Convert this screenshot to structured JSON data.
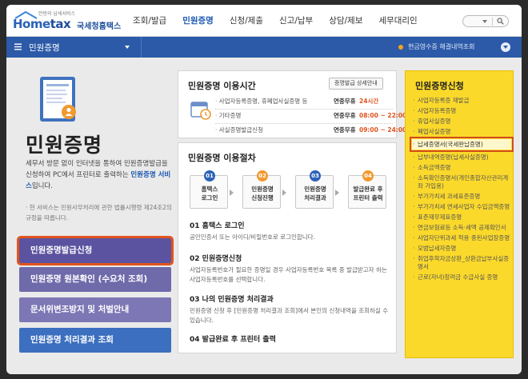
{
  "header": {
    "logo_tagline": "안방의 납세서비스",
    "logo_home": "Home",
    "logo_tax": "tax",
    "logo_korean": "국세청홈택스",
    "nav": [
      "조회/발급",
      "민원증명",
      "신청/제출",
      "신고/납부",
      "상담/제보",
      "세무대리인"
    ],
    "active_nav": "민원증명"
  },
  "subbar": {
    "title": "민원증명",
    "notice": "현금영수증 해결내역조회"
  },
  "left": {
    "title": "민원증명",
    "desc_pre": "세무서 방문 없이 인터넷을 통하여 민원증명발급을 신청하여 PC에서 프린터로 출력하는 ",
    "desc_hl": "민원증명 서비스",
    "desc_post": "입니다.",
    "note": "· 현 서비스는 민원사무처리에 관한 법률시행령 제24조2의 규정을 따릅니다.",
    "buttons": [
      "민원증명발급신청",
      "민원증명 원본확인 (수요처 조회)",
      "문서위변조방지 및 처벌안내",
      "민원증명 처리결과 조회"
    ]
  },
  "hours": {
    "title": "민원증명 이용시간",
    "detail_button": "증명발급 상세안내",
    "rows": [
      {
        "service": "사업자등록증명, 휴폐업사실증명 등",
        "days": "연중무휴",
        "time": "24시간"
      },
      {
        "service": "기타증명",
        "days": "연중무휴",
        "time": "08:00 ~ 22:00"
      },
      {
        "service": "사실증명발급신청",
        "days": "연중무휴",
        "time": "09:00 ~ 24:00"
      }
    ]
  },
  "procedure": {
    "title": "민원증명 이용절차",
    "steps": [
      {
        "num": "01",
        "l1": "홈택스",
        "l2": "로그인"
      },
      {
        "num": "02",
        "l1": "민원증명",
        "l2": "신청진행"
      },
      {
        "num": "03",
        "l1": "민원증명",
        "l2": "처리결과"
      },
      {
        "num": "04",
        "l1": "발급완료 후",
        "l2": "프린터 출력"
      }
    ],
    "details": [
      {
        "heading": "01 홈택스 로그인",
        "desc": "공인인증서 또는 아이디/비밀번호로 로그인합니다."
      },
      {
        "heading": "02 민원증명신청",
        "desc": "사업자등록번호가 필요한 증명일 경우 사업자등록번호 목록 중 발급받고자 하는 사업자등록번호를 선택합니다."
      },
      {
        "heading": "03 나의 민원증명 처리결과",
        "desc": "민원증명 신청 후 [민원증명 처리결과 조회]에서 본인의 신청내역을 조회하실 수 있습니다."
      },
      {
        "heading": "04 발급완료 후 프린터 출력",
        "desc": ""
      }
    ]
  },
  "right": {
    "title": "민원증명신청",
    "items": [
      "사업자등록증 재발급",
      "사업자등록증명",
      "휴업사실증명",
      "폐업사실증명",
      "납세증명서(국세완납증명)",
      "납부내역증명(납세사실증명)",
      "소득금액증명",
      "소득확인증명서(개인종합자산관리계좌 가입용)",
      "부가가치세 과세표준증명",
      "부가가치세 면세사업자 수입금액증명",
      "표준재무제표증명",
      "연금보험료등 소득·세액 공제확인서",
      "사업자단위과세 적용 종된사업장증명",
      "모범납세자증명",
      "취업후학자금상환_상환금납부사실증명서",
      "근로(자녀)장려금 수급사실 증명"
    ],
    "highlighted_index": 4
  },
  "colors": {
    "accent_blue": "#2c5aa8",
    "highlight_border": "#e0541d",
    "panel_yellow": "#fbd92b",
    "button_purple": "#5c53a0"
  }
}
